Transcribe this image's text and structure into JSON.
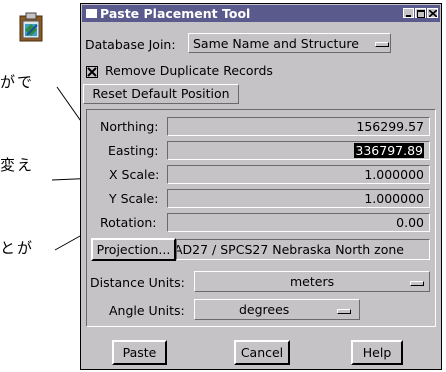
{
  "background_text": {
    "line1": "がで",
    "line2": "変え",
    "line3": "とが"
  },
  "window": {
    "title": "Paste Placement Tool",
    "title_bar_color": "#5a5a8c",
    "body_color": "#c6c3c6"
  },
  "database_join": {
    "label": "Database Join:",
    "value": "Same Name and Structure"
  },
  "remove_duplicates": {
    "label": "Remove Duplicate Records",
    "checked": true
  },
  "reset_button": {
    "label": "Reset Default Position"
  },
  "fields": {
    "northing": {
      "label": "Northing:",
      "value": "156299.57"
    },
    "easting": {
      "label": "Easting:",
      "value": "336797.89"
    },
    "x_scale": {
      "label": "X Scale:",
      "value": "1.000000"
    },
    "y_scale": {
      "label": "Y Scale:",
      "value": "1.000000"
    },
    "rotation": {
      "label": "Rotation:",
      "value": "0.00"
    }
  },
  "projection": {
    "button_label": "Projection...",
    "value": "AD27 / SPCS27 Nebraska North zone"
  },
  "distance_units": {
    "label": "Distance Units:",
    "value": "meters"
  },
  "angle_units": {
    "label": "Angle Units:",
    "value": "degrees"
  },
  "buttons": {
    "paste": "Paste",
    "cancel": "Cancel",
    "help": "Help"
  }
}
